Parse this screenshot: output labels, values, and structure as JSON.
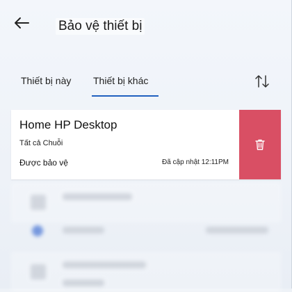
{
  "header": {
    "title": "Bảo vệ thiết bị",
    "back_icon": "arrow-left-icon"
  },
  "tabs": [
    {
      "label": "Thiết bị này",
      "selected": false
    },
    {
      "label": "Thiết bị khác",
      "selected": true
    }
  ],
  "sort_icon": "sort-arrows-icon",
  "device": {
    "name": "Home HP Desktop",
    "group": "Tất cả Chuỗi",
    "status": "Được bảo vệ",
    "updated": "Đã cập nhật 12:11PM",
    "delete_icon": "trash-icon"
  },
  "colors": {
    "accent": "#1f5fbf",
    "delete_bg": "#d94f64"
  }
}
